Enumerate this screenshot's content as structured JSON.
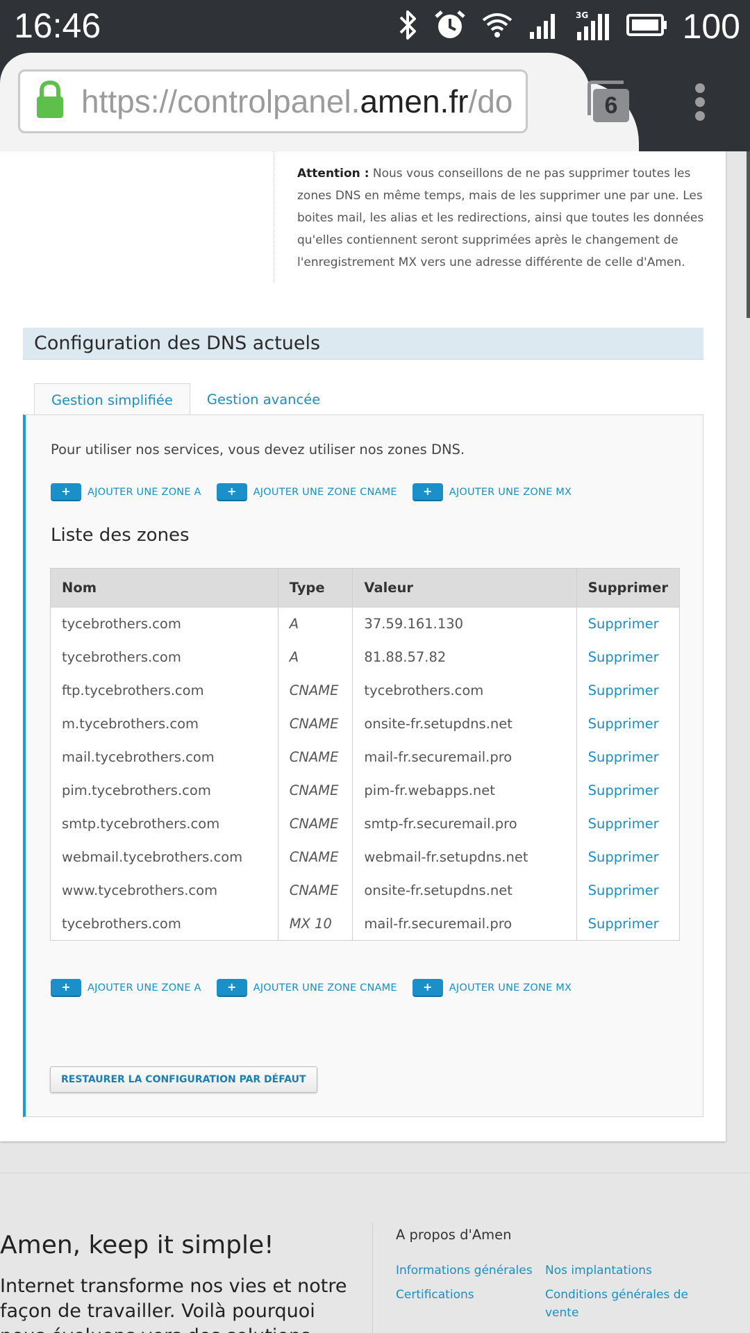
{
  "status_bar": {
    "time": "16:46",
    "battery": "100",
    "network": "3G"
  },
  "browser": {
    "url_prefix": "https://controlpanel.",
    "url_host": "amen.fr",
    "url_suffix": "/do",
    "tab_count": "6"
  },
  "attention": {
    "label": "Attention :",
    "text": " Nous vous conseillons de ne pas supprimer toutes les zones DNS en même temps, mais de les supprimer une par une. Les boites mail, les alias et les redirections, ainsi que toutes les données qu'elles contiennent seront supprimées après le changement de l'enregistrement MX vers une adresse différente de celle d'Amen."
  },
  "section_title": "Configuration des DNS actuels",
  "tabs": [
    {
      "label": "Gestion simplifiée",
      "active": true
    },
    {
      "label": "Gestion avancée",
      "active": false
    }
  ],
  "intro": "Pour utiliser nos services, vous devez utiliser nos zones DNS.",
  "add_buttons": [
    {
      "icon": "+",
      "label": "AJOUTER UNE ZONE A"
    },
    {
      "icon": "+",
      "label": "AJOUTER UNE ZONE CNAME"
    },
    {
      "icon": "+",
      "label": "AJOUTER UNE ZONE MX"
    }
  ],
  "list_title": "Liste des zones",
  "table": {
    "headers": [
      "Nom",
      "Type",
      "Valeur",
      "Supprimer"
    ],
    "rows": [
      {
        "nom": "tycebrothers.com",
        "type": "A",
        "valeur": "37.59.161.130",
        "action": "Supprimer"
      },
      {
        "nom": "tycebrothers.com",
        "type": "A",
        "valeur": "81.88.57.82",
        "action": "Supprimer"
      },
      {
        "nom": "ftp.tycebrothers.com",
        "type": "CNAME",
        "valeur": "tycebrothers.com",
        "action": "Supprimer"
      },
      {
        "nom": "m.tycebrothers.com",
        "type": "CNAME",
        "valeur": "onsite-fr.setupdns.net",
        "action": "Supprimer"
      },
      {
        "nom": "mail.tycebrothers.com",
        "type": "CNAME",
        "valeur": "mail-fr.securemail.pro",
        "action": "Supprimer"
      },
      {
        "nom": "pim.tycebrothers.com",
        "type": "CNAME",
        "valeur": "pim-fr.webapps.net",
        "action": "Supprimer"
      },
      {
        "nom": "smtp.tycebrothers.com",
        "type": "CNAME",
        "valeur": "smtp-fr.securemail.pro",
        "action": "Supprimer"
      },
      {
        "nom": "webmail.tycebrothers.com",
        "type": "CNAME",
        "valeur": "webmail-fr.setupdns.net",
        "action": "Supprimer"
      },
      {
        "nom": "www.tycebrothers.com",
        "type": "CNAME",
        "valeur": "onsite-fr.setupdns.net",
        "action": "Supprimer"
      },
      {
        "nom": "tycebrothers.com",
        "type": "MX 10",
        "valeur": "mail-fr.securemail.pro",
        "action": "Supprimer"
      }
    ]
  },
  "restore_button": "RESTAURER LA CONFIGURATION PAR DÉFAUT",
  "footer": {
    "tagline": "Amen, keep it simple!",
    "description": "Internet transforme nos vies et notre façon de travailler. Voilà pourquoi nous évoluons vers des solutions",
    "about_title": "A propos d'Amen",
    "links": [
      "Informations générales",
      "Nos implantations",
      "Certifications",
      "Conditions générales de vente"
    ]
  },
  "colors": {
    "accent": "#1a8fc0",
    "button_blue": "#1a8fc8",
    "section_bg": "#dde9f0",
    "statusbar": "#2f3236",
    "lock_green": "#5cc04b"
  }
}
